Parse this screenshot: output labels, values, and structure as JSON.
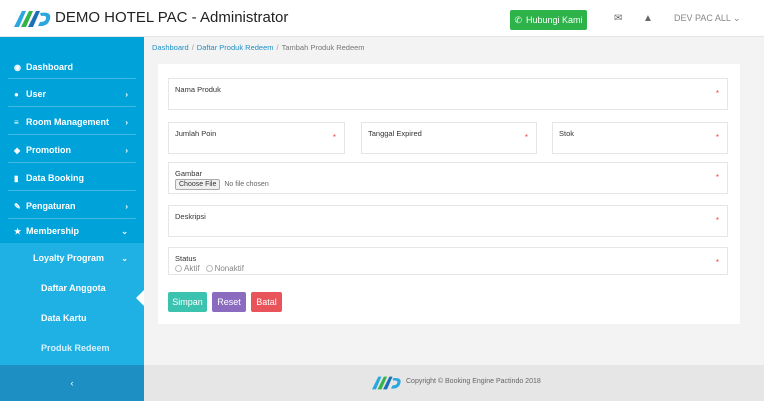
{
  "header": {
    "title": "DEMO HOTEL PAC - Administrator",
    "logo_text": "PAC",
    "contact_button": "Hubungi Kami",
    "user_label": "DEV PAC ALL"
  },
  "sidebar": {
    "items": [
      {
        "label": "Dashboard",
        "icon": "dashboard-icon",
        "chevron": false
      },
      {
        "label": "User",
        "icon": "user-icon",
        "chevron": true
      },
      {
        "label": "Room Management",
        "icon": "list-icon",
        "chevron": true
      },
      {
        "label": "Promotion",
        "icon": "tag-icon",
        "chevron": true
      },
      {
        "label": "Data Booking",
        "icon": "book-icon",
        "chevron": false
      },
      {
        "label": "Pengaturan",
        "icon": "wrench-icon",
        "chevron": true
      },
      {
        "label": "Membership",
        "icon": "star-icon",
        "chevron": true
      }
    ],
    "submenu": {
      "parent": "Loyalty Program",
      "children": [
        "Daftar Anggota",
        "Data Kartu",
        "Produk Redeem"
      ],
      "active": "Produk Redeem"
    },
    "collapse_glyph": "‹"
  },
  "breadcrumb": [
    "Dashboard",
    "Daftar Produk Redeem",
    "Tambah Produk Redeem"
  ],
  "form": {
    "nama_produk": "Nama Produk",
    "jumlah_poin": "Jumlah Poin",
    "tanggal_expired": "Tanggal Expired",
    "stok": "Stok",
    "gambar": "Gambar",
    "file_button": "Choose File",
    "file_status": "No file chosen",
    "deskripsi": "Deskripsi",
    "status": "Status",
    "status_options": [
      "Aktif",
      "Nonaktif"
    ],
    "required_mark": "*"
  },
  "buttons": {
    "save": "Simpan",
    "reset": "Reset",
    "cancel": "Batal"
  },
  "footer": {
    "copyright": "Copyright © Booking Engine Pactindo 2018"
  },
  "colors": {
    "sidebar": "#00a3d9",
    "contact": "#2db34a",
    "save": "#3cc3b0",
    "reset": "#8a6bbf",
    "cancel": "#e9535a"
  }
}
